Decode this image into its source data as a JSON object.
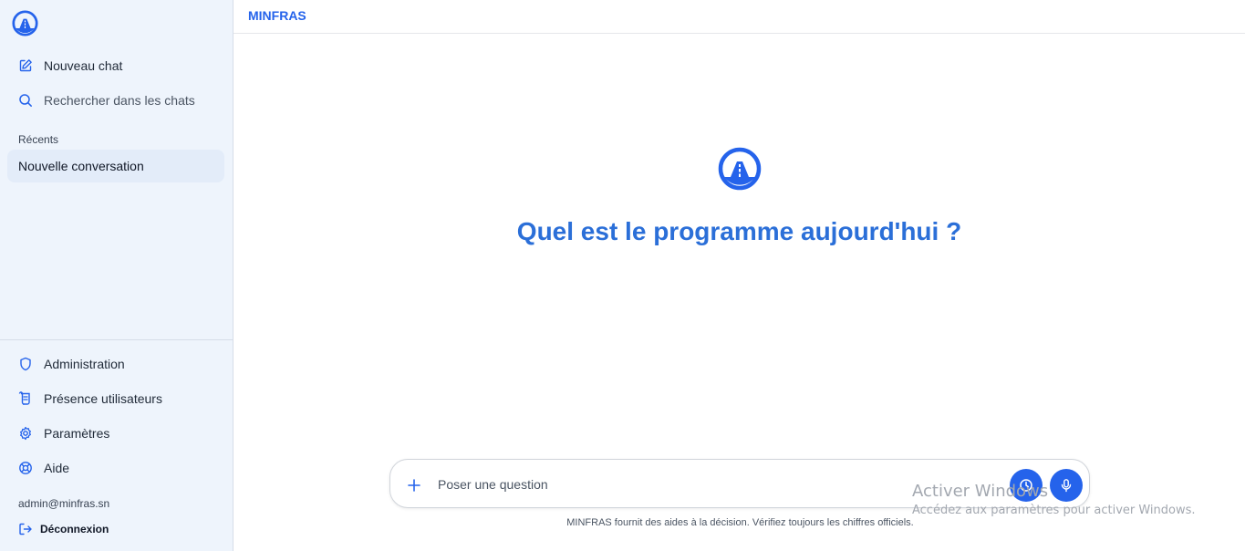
{
  "sidebar": {
    "nav": {
      "new_chat": "Nouveau chat",
      "search": "Rechercher dans les chats"
    },
    "recents_title": "Récents",
    "conversations": [
      "Nouvelle conversation"
    ],
    "bottom": {
      "admin": "Administration",
      "presence": "Présence utilisateurs",
      "settings": "Paramètres",
      "help": "Aide"
    },
    "user_email": "admin@minfras.sn",
    "logout": "Déconnexion"
  },
  "header": {
    "brand": "MINFRAS"
  },
  "main": {
    "headline": "Quel est le programme aujourd'hui ?",
    "composer_placeholder": "Poser une question",
    "disclaimer": "MINFRAS fournit des aides à la décision. Vérifiez toujours les chiffres officiels."
  },
  "watermark": {
    "title": "Activer Windows",
    "subtitle": "Accédez aux paramètres pour activer Windows."
  },
  "colors": {
    "accent": "#2563eb",
    "sidebar_bg": "#eef4fc",
    "active_item": "#e3ecf9"
  },
  "icons": [
    "road-logo-icon",
    "edit-icon",
    "search-icon",
    "shield-icon",
    "scroll-icon",
    "gear-icon",
    "lifebuoy-icon",
    "logout-icon",
    "plus-icon",
    "clock-icon",
    "mic-icon"
  ]
}
